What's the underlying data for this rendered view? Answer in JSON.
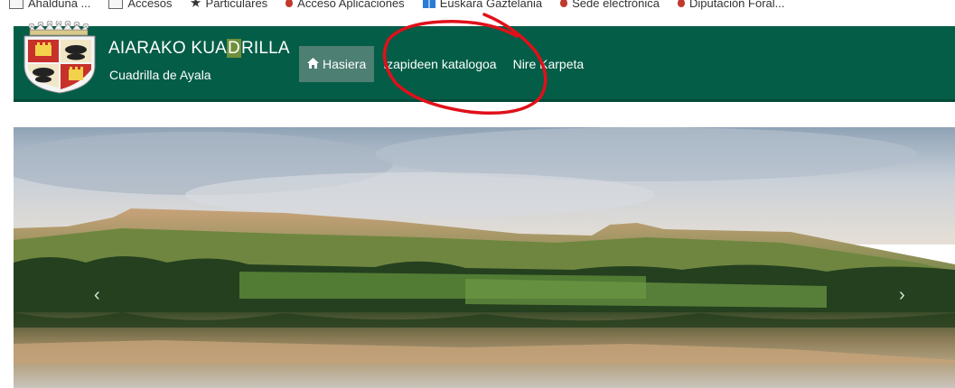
{
  "bookmarks": [
    {
      "label": "Ahalduna ..."
    },
    {
      "label": "Accesos"
    },
    {
      "label": "Particulares"
    },
    {
      "label": "Acceso Aplicaciones"
    },
    {
      "label": "Euskara Gaztelania"
    },
    {
      "label": "Sede electrónica"
    },
    {
      "label": "Diputación Foral..."
    }
  ],
  "brand": {
    "title_part1": "AIARAKO KUA",
    "title_highlight": "D",
    "title_part2": "RILLA",
    "subtitle": "Cuadrilla de Ayala"
  },
  "nav": {
    "home_icon": "home-icon",
    "items": [
      {
        "label": "Hasiera",
        "active": true
      },
      {
        "label": "Izapideen katalogoa",
        "active": false
      },
      {
        "label": "Nire Karpeta",
        "active": false
      }
    ]
  },
  "carousel": {
    "prev_icon": "chevron-left-icon",
    "next_icon": "chevron-right-icon",
    "prev_glyph": "‹",
    "next_glyph": "›"
  },
  "colors": {
    "header_bg": "#045d47",
    "nav_active_bg": "#4d7f72",
    "annotation_red": "#e0101a"
  }
}
